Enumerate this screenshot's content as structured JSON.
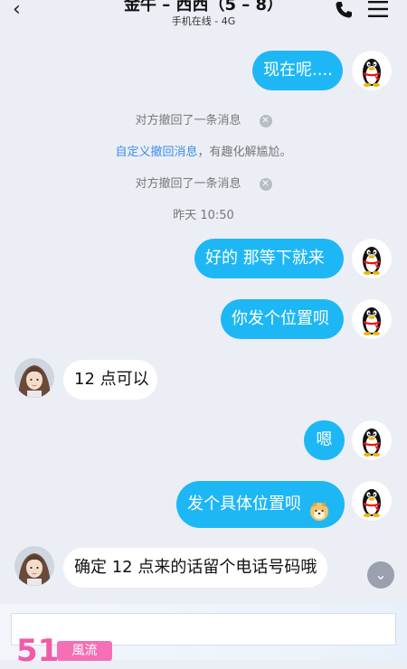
{
  "header": {
    "back_icon": "‹",
    "title": "金牛 – 西西（5 – 8）",
    "subtitle": "手机在线 - 4G"
  },
  "messages": {
    "m1": "现在呢....",
    "recall1": "对方撤回了一条消息",
    "custom_recall_link": "自定义撤回消息",
    "custom_recall_rest": "，有趣化解尴尬。",
    "recall2": "对方撤回了一条消息",
    "timestamp": "昨天 10:50",
    "m2": "好的  那等下就来",
    "m3": "你发个位置呗",
    "m4": "12 点可以",
    "m5": "嗯",
    "m6": "发个具体位置呗",
    "m7": "确定 12 点来的话留个电话号码哦"
  },
  "footer": {
    "brand_number": "51",
    "brand_tag": "風流",
    "scroll_down_icon": "⌄"
  },
  "colors": {
    "background": "#eceef6",
    "my_bubble": "#1eb7f5",
    "their_bubble": "#ffffff",
    "link": "#3a8ee6",
    "brand_pink": "#f15ba8"
  },
  "icons": [
    "back-icon",
    "phone-icon",
    "menu-icon",
    "qq-penguin-avatar",
    "girl-avatar",
    "close-circle-icon",
    "shiba-emoji",
    "chevron-down-icon"
  ]
}
